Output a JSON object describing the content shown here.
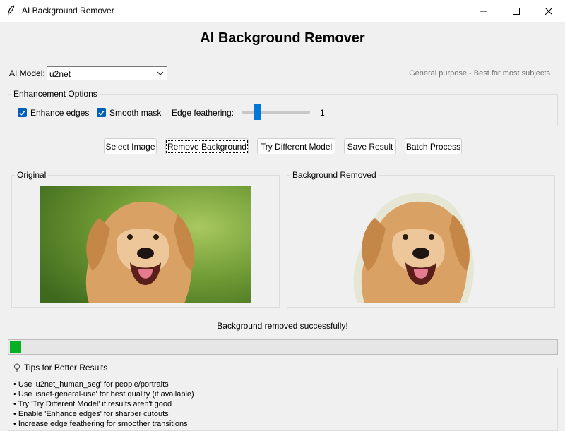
{
  "window": {
    "title": "AI Background Remover",
    "icon": "feather-icon"
  },
  "header": {
    "title": "AI Background Remover"
  },
  "model": {
    "label": "AI Model:",
    "selected": "u2net",
    "description": "General purpose - Best for most subjects"
  },
  "enhancement": {
    "group_label": "Enhancement Options",
    "enhance_edges": {
      "label": "Enhance edges",
      "checked": true
    },
    "smooth_mask": {
      "label": "Smooth mask",
      "checked": true
    },
    "feathering": {
      "label": "Edge feathering:",
      "value": "1",
      "level_fraction": 0.2
    }
  },
  "buttons": {
    "select_image": "Select Image",
    "remove_background": "Remove Background",
    "try_model": "Try Different Model",
    "save_result": "Save Result",
    "batch_process": "Batch Process"
  },
  "panels": {
    "original": "Original",
    "result": "Background Removed"
  },
  "status": {
    "message": "Background removed successfully!",
    "progress_fraction": 0.02,
    "progress_color": "#06b025"
  },
  "tips": {
    "title": "Tips for Better Results",
    "items": [
      "• Use 'u2net_human_seg' for people/portraits",
      "• Use 'isnet-general-use' for best quality (if available)",
      "• Try 'Try Different Model' if results aren't good",
      "• Enable 'Enhance edges' for sharper cutouts",
      "• Increase edge feathering for smoother transitions"
    ]
  },
  "colors": {
    "accent": "#0078d4",
    "checkbox": "#005fb8"
  }
}
